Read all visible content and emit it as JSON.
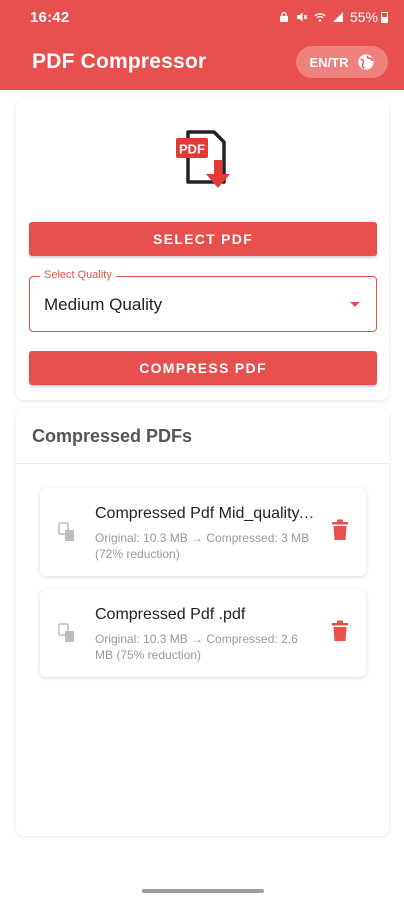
{
  "status_bar": {
    "time": "16:42",
    "battery": "55%"
  },
  "app_bar": {
    "title": "PDF Compressor",
    "language_toggle": "EN/TR",
    "globe_icon": "globe-icon"
  },
  "logo": {
    "text": "PDF",
    "icon": "pdf-download-icon",
    "brand_color": "#e53935"
  },
  "actions": {
    "select_pdf": "SELECT PDF",
    "compress_pdf": "COMPRESS PDF"
  },
  "quality": {
    "label": "Select Quality",
    "selected": "Medium Quality"
  },
  "compressed_list": {
    "title": "Compressed PDFs",
    "items": [
      {
        "name": "Compressed Pdf Mid_quality.pdf",
        "info": "Original: 10.3 MB → Compressed: 3 MB (72% reduction)"
      },
      {
        "name": "Compressed Pdf .pdf",
        "info": "Original: 10.3 MB → Compressed: 2.6 MB (75% reduction)"
      }
    ]
  },
  "colors": {
    "accent": "#e8504d",
    "delete_icon": "#e8504d",
    "muted_text": "#9a9a9a"
  }
}
